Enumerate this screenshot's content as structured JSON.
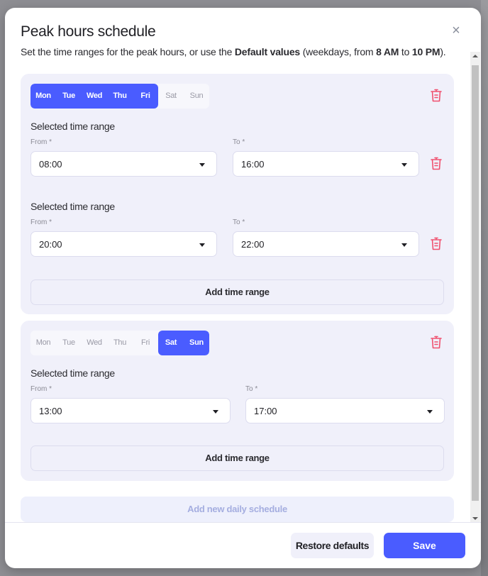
{
  "dialog": {
    "title": "Peak hours schedule",
    "close_icon": "×",
    "subtitle": {
      "prefix": "Set the time ranges for the peak hours, or use the ",
      "bold1": "Default values",
      "middle": " (weekdays, from ",
      "bold2": "8 AM",
      "to": " to ",
      "bold3": "10 PM",
      "suffix": ")."
    }
  },
  "colors": {
    "accent": "#4a5cff",
    "card_bg": "#f0f0fa",
    "danger": "#f0506e"
  },
  "schedules": [
    {
      "days": [
        {
          "label": "Mon",
          "selected": true
        },
        {
          "label": "Tue",
          "selected": true
        },
        {
          "label": "Wed",
          "selected": true
        },
        {
          "label": "Thu",
          "selected": true
        },
        {
          "label": "Fri",
          "selected": true
        },
        {
          "label": "Sat",
          "selected": false
        },
        {
          "label": "Sun",
          "selected": false
        }
      ],
      "ranges": [
        {
          "title": "Selected time range",
          "from_label": "From *",
          "from": "08:00",
          "to_label": "To *",
          "to": "16:00"
        },
        {
          "title": "Selected time range",
          "from_label": "From *",
          "from": "20:00",
          "to_label": "To *",
          "to": "22:00"
        }
      ],
      "add_range_label": "Add time range"
    },
    {
      "days": [
        {
          "label": "Mon",
          "selected": false
        },
        {
          "label": "Tue",
          "selected": false
        },
        {
          "label": "Wed",
          "selected": false
        },
        {
          "label": "Thu",
          "selected": false
        },
        {
          "label": "Fri",
          "selected": false
        },
        {
          "label": "Sat",
          "selected": true
        },
        {
          "label": "Sun",
          "selected": true
        }
      ],
      "ranges": [
        {
          "title": "Selected time range",
          "from_label": "From *",
          "from": "13:00",
          "to_label": "To *",
          "to": "17:00"
        }
      ],
      "add_range_label": "Add time range"
    }
  ],
  "add_daily_schedule_label": "Add new daily schedule",
  "footer": {
    "restore_label": "Restore defaults",
    "save_label": "Save"
  }
}
